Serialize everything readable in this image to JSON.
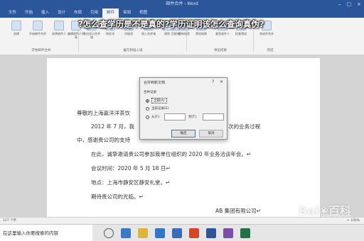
{
  "overlay": {
    "title": "?怎么查学历是不是真的?学历证明该怎么查询真伪?"
  },
  "window": {
    "title": "邮件合并 - Word"
  },
  "ribbon": {
    "tabs": [
      "文件",
      "开始",
      "插入",
      "设计",
      "布局",
      "引用",
      "邮件",
      "审阅",
      "视图"
    ],
    "active_tab_index": 6,
    "tools": [
      "创建",
      "开始邮件合并",
      "选择收件人",
      "编辑收件人列表",
      "突出显示合并域",
      "地址块",
      "问候语",
      "插入合并域",
      "规则",
      "匹配域",
      "更新标签",
      "预览结果",
      "查找收件人",
      "检查错误",
      "完成并合并"
    ],
    "groups": [
      "开始邮件合并",
      "编写和插入域",
      "预览结果",
      "完成"
    ]
  },
  "document": {
    "lines": [
      "尊敬的上海嘉洋洋茶饮",
      "2012 年 7 月，我",
      "0 次的业务过程",
      "中，感谢贵公司的支持",
      "在此，诚挚邀请贵公司参加我单位组织的 2020 年业务洽谈年会。↵",
      "会议时间：2020 年 5 月 18 日↵",
      "地点：上海市静安区静安礼堂。↵",
      "期待贵公司的光临。↵",
      "AB 集团有限公司↵"
    ]
  },
  "dialog": {
    "title": "合并到新文档",
    "help": "?",
    "close": "×",
    "group_label": "合并记录",
    "options": [
      "全部(A)",
      "当前记录(E)",
      "从(F):"
    ],
    "to_label": "到(T):",
    "selected_option": 0,
    "ok_label": "确定",
    "cancel_label": "取消"
  },
  "statusbar": {
    "left": "127 个字",
    "right": "+ 100%"
  },
  "taskbar": {
    "search_placeholder": "在这里输入你要搜索的内容"
  },
  "watermark": {
    "text": "Bai❀百科",
    "sub": "baike.baidu.com"
  }
}
